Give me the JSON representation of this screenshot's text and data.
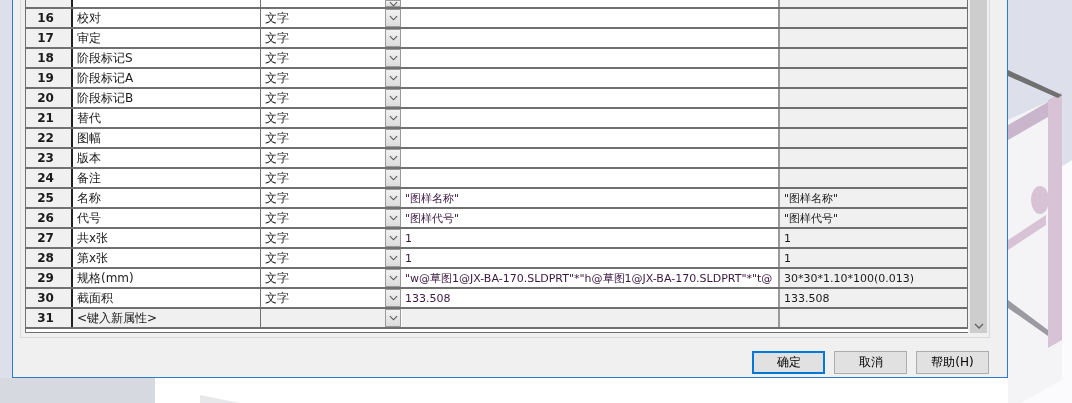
{
  "dialog": {
    "table": {
      "rows": [
        {
          "number": "16",
          "name": "校对",
          "type": "文字"
        },
        {
          "number": "17",
          "name": "审定",
          "type": "文字"
        },
        {
          "number": "18",
          "name": "阶段标记S",
          "type": "文字"
        },
        {
          "number": "19",
          "name": "阶段标记A",
          "type": "文字"
        },
        {
          "number": "20",
          "name": "阶段标记B",
          "type": "文字"
        },
        {
          "number": "21",
          "name": "替代",
          "type": "文字"
        },
        {
          "number": "22",
          "name": "图幅",
          "type": "文字"
        },
        {
          "number": "23",
          "name": "版本",
          "type": "文字"
        },
        {
          "number": "24",
          "name": "备注",
          "type": "文字"
        },
        {
          "number": "25",
          "name": "名称",
          "type": "文字",
          "value": "\"图样名称\"",
          "evaluated": "\"图样名称\""
        },
        {
          "number": "26",
          "name": "代号",
          "type": "文字",
          "value": "\"图样代号\"",
          "evaluated": "\"图样代号\""
        },
        {
          "number": "27",
          "name": "共x张",
          "type": "文字",
          "value": "1",
          "evaluated": "1"
        },
        {
          "number": "28",
          "name": "第x张",
          "type": "文字",
          "value": "1",
          "evaluated": "1"
        },
        {
          "number": "29",
          "name": "规格(mm)",
          "type": "文字",
          "value": "\"w@草图1@JX-BA-170.SLDPRT\"*\"h@草图1@JX-BA-170.SLDPRT\"*\"t@",
          "evaluated": "30*30*1.10*100(0.013)"
        },
        {
          "number": "30",
          "name": "截面积",
          "type": "文字",
          "value": "133.508",
          "evaluated": "133.508"
        },
        {
          "number": "31",
          "name": "<键入新属性>",
          "kind": "new"
        }
      ]
    },
    "buttons": [
      {
        "label": "确定",
        "default": true
      },
      {
        "label": "取消",
        "default": false
      },
      {
        "label": "帮助(H)",
        "default": false
      }
    ]
  }
}
